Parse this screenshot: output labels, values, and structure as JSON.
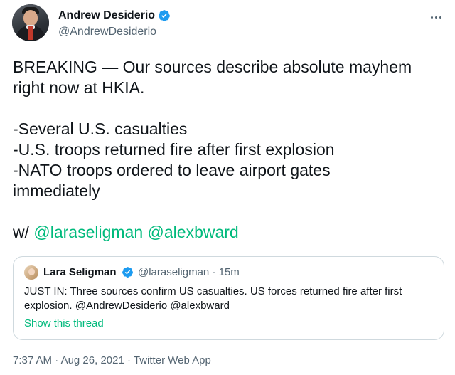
{
  "author": {
    "display_name": "Andrew Desiderio",
    "handle": "@AndrewDesiderio",
    "verified": true
  },
  "tweet": {
    "lines": {
      "l1": "BREAKING — Our sources describe absolute mayhem",
      "l2": "right now at HKIA.",
      "l4": "-Several U.S. casualties",
      "l5": "-U.S. troops returned fire after first explosion",
      "l6": "-NATO troops ordered to leave airport gates",
      "l7": "immediately",
      "l9_prefix": "w/ "
    },
    "mentions": [
      "@laraseligman",
      "@alexbward"
    ]
  },
  "quoted_tweet": {
    "display_name": "Lara Seligman",
    "handle": "@laraseligman",
    "separator": "·",
    "time": "15m",
    "text_line1": "JUST IN: Three sources confirm US casualties. US forces returned fire after first",
    "text_line2": "explosion. @AndrewDesiderio @alexbward",
    "show_thread": "Show this thread"
  },
  "footer": {
    "time": "7:37 AM",
    "sep1": "·",
    "date": "Aug 26, 2021",
    "sep2": "·",
    "source": "Twitter Web App"
  },
  "colors": {
    "mention": "#00ba7c",
    "verified": "#1d9bf0",
    "secondary_text": "#536471"
  },
  "icons": {
    "verified": "verified-badge-icon",
    "more": "more-options-icon"
  }
}
